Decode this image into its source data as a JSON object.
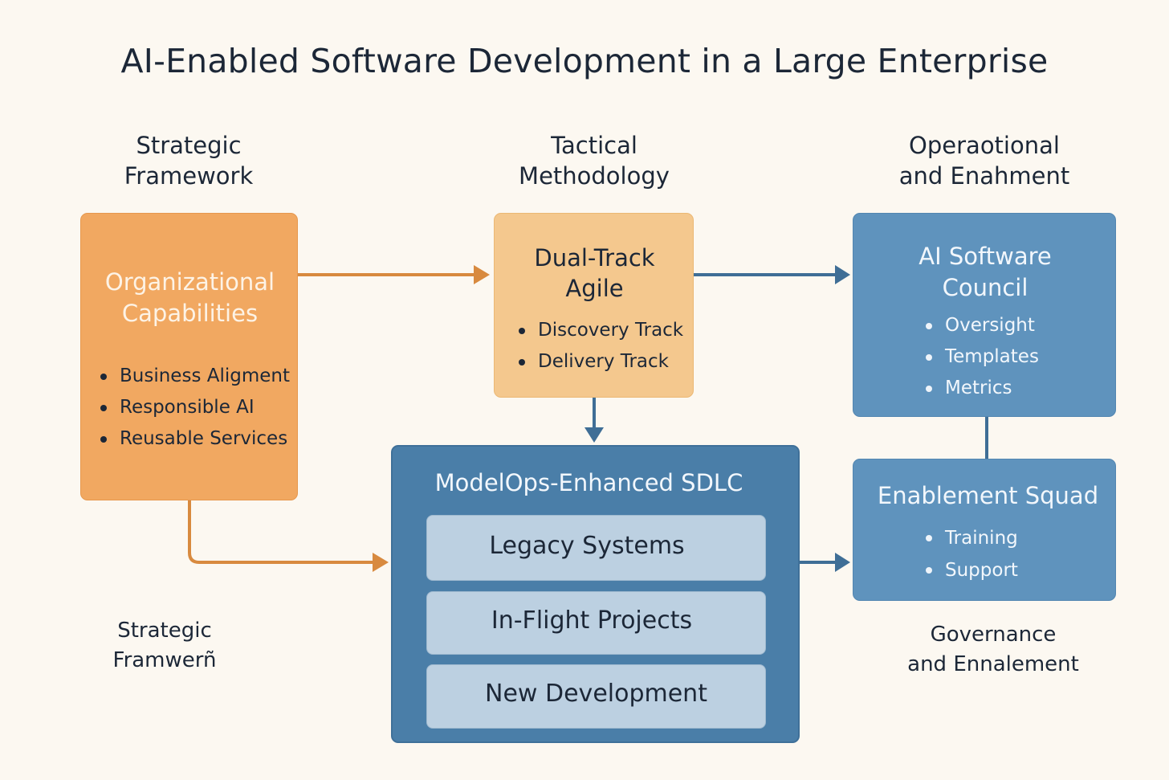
{
  "title": "AI-Enabled Software Development in a Large Enterprise",
  "columns": {
    "left": [
      "Strategic",
      "Framework"
    ],
    "middle": [
      "Tactical",
      "Methodology"
    ],
    "right": [
      "Operaotional",
      "and Enahment"
    ]
  },
  "org_box": {
    "title": [
      "Organizational",
      "Capabilities"
    ],
    "items": [
      "Business Aligment",
      "Responsible AI",
      "Reusable Services"
    ]
  },
  "agile_box": {
    "title": [
      "Dual-Track",
      "Agile"
    ],
    "items": [
      "Discovery Track",
      "Delivery Track"
    ]
  },
  "council_box": {
    "title": [
      "AI Software",
      "Council"
    ],
    "items": [
      "Oversight",
      "Templates",
      "Metrics"
    ]
  },
  "sdlc_box": {
    "title": "ModelOps-Enhanced SDLC",
    "items": [
      "Legacy Systems",
      "In-Flight Projects",
      "New Development"
    ]
  },
  "squad_box": {
    "title": "Enablement Squad",
    "items": [
      "Training",
      "Support"
    ]
  },
  "bottom_left_label": [
    "Strategic",
    "Framwerñ"
  ],
  "bottom_right_label": [
    "Governance",
    "and Ennalement"
  ],
  "colors": {
    "background": "#fcf8f1",
    "orange": "#f1a861",
    "tan": "#f4c88e",
    "blue": "#5f93bd",
    "dark_blue": "#4a7ea8",
    "arrow_orange": "#d88a3f",
    "arrow_blue": "#3f6e96"
  }
}
